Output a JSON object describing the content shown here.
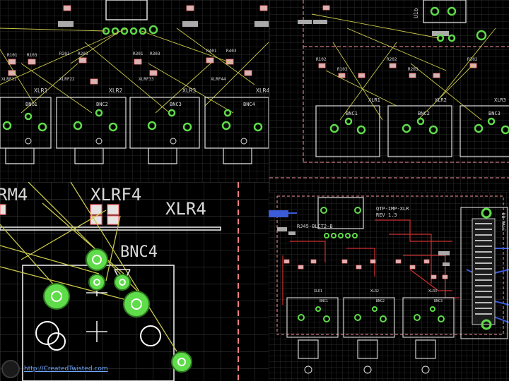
{
  "panels": {
    "top_left": {
      "xlr_labels": [
        "XLR1",
        "XLR2",
        "XLR3",
        "XLR4"
      ],
      "bnc_labels": [
        "BNC1",
        "BNC2",
        "BNC3",
        "BNC4"
      ],
      "resistor_labels": [
        "R101",
        "R103",
        "R201",
        "R203",
        "R301",
        "R303",
        "R401",
        "R403"
      ],
      "xlrf_labels": [
        "XLRF11",
        "XLRF22",
        "XLRF33",
        "XLRF44"
      ]
    },
    "top_right": {
      "xlr_labels": [
        "XLR1",
        "XLR2",
        "XLR3"
      ],
      "bnc_labels": [
        "BNC1",
        "BNC2",
        "BNC3"
      ],
      "resistor_labels": [
        "R102",
        "R103",
        "R202",
        "R203",
        "R302"
      ],
      "ic_label": "U1b"
    },
    "bottom_left": {
      "xlr_partial": "RM4",
      "xlrf_label": "XLRF4",
      "xlr_label": "XLR4",
      "bnc_label": "BNC4"
    },
    "bottom_right": {
      "board_title": "QTP-IMP-XLR",
      "revision": "REV 1.3",
      "connector_label": "RJ45-BLCT2-B",
      "side_label": "DB-MALE",
      "xlr_labels": [
        "XLR1",
        "XLR2",
        "XLR3"
      ],
      "bnc_labels": [
        "BNC1",
        "BNC2",
        "BNC3"
      ]
    }
  },
  "credit": {
    "url": "http://CreatedTwisted.com"
  }
}
